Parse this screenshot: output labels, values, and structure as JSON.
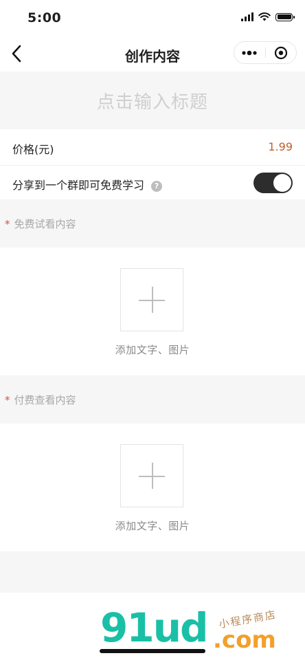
{
  "status_bar": {
    "time": "5:00"
  },
  "nav": {
    "title": "创作内容",
    "back_icon": "chevron-left-icon",
    "more_icon": "more-dots-icon",
    "close_icon": "target-circle-icon"
  },
  "title_input": {
    "placeholder": "点击输入标题",
    "value": ""
  },
  "price_row": {
    "label": "价格(元)",
    "value": "1.99"
  },
  "share_row": {
    "label": "分享到一个群即可免费学习",
    "help_glyph": "?",
    "toggle_on": true
  },
  "free_section": {
    "required_mark": "*",
    "title": "免费试看内容",
    "add_label": "添加文字、图片"
  },
  "paid_section": {
    "required_mark": "*",
    "title": "付费查看内容",
    "add_label": "添加文字、图片"
  },
  "watermark": {
    "logo": "91ud",
    "subtitle": "小程序商店",
    "domain": ".com"
  },
  "colors": {
    "price": "#c0602d",
    "required": "#e0484c",
    "toggle_track": "#2d2d2d",
    "section_bg": "#f6f6f6"
  }
}
